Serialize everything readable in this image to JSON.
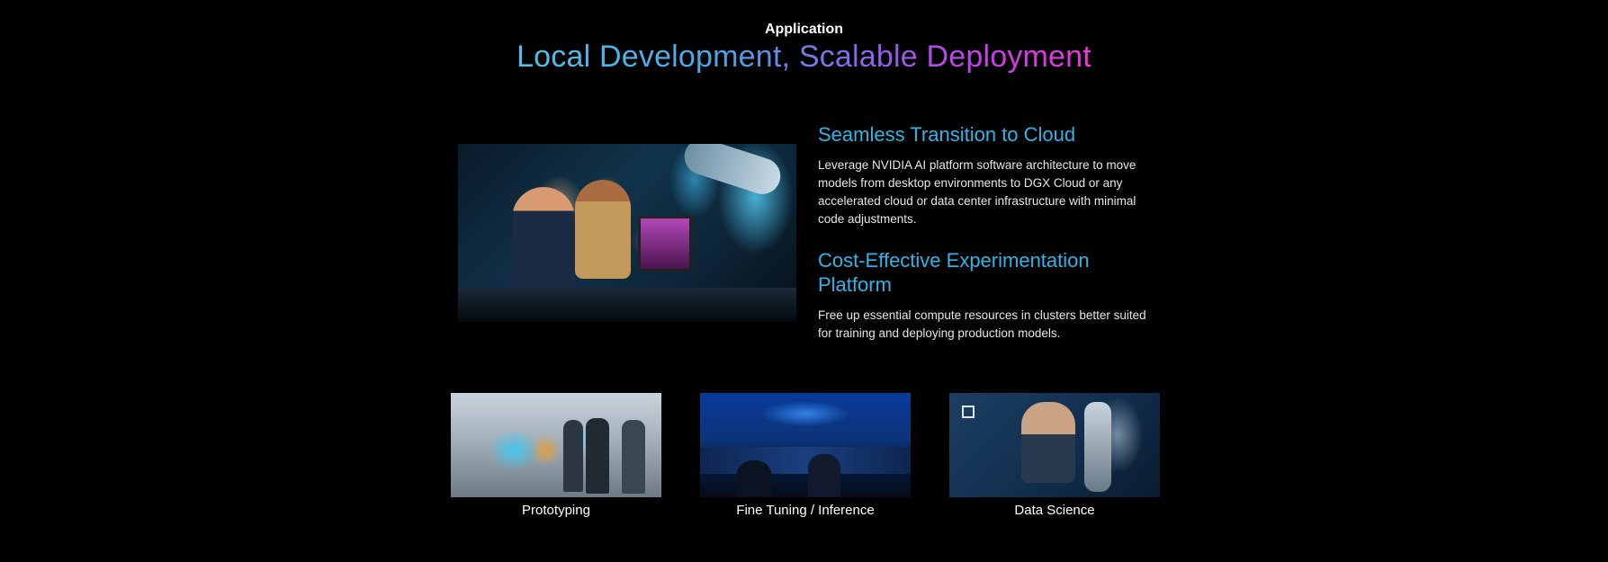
{
  "header": {
    "eyebrow": "Application",
    "title": "Local Development, Scalable Deployment"
  },
  "sections": [
    {
      "title": "Seamless Transition to Cloud",
      "body": "Leverage NVIDIA AI platform software architecture to move models from desktop environments to DGX Cloud or any accelerated cloud or data center infrastructure with minimal code adjustments."
    },
    {
      "title": "Cost-Effective Experimentation Platform",
      "body": "Free up essential compute resources in clusters better suited for training and deploying production models."
    }
  ],
  "cards": [
    {
      "label": "Prototyping"
    },
    {
      "label": "Fine Tuning / Inference"
    },
    {
      "label": "Data Science"
    }
  ],
  "colors": {
    "background": "#000000",
    "section_title": "#2cb6e8",
    "title_gradient_start": "#4fc3e8",
    "title_gradient_end": "#e83ad8"
  }
}
